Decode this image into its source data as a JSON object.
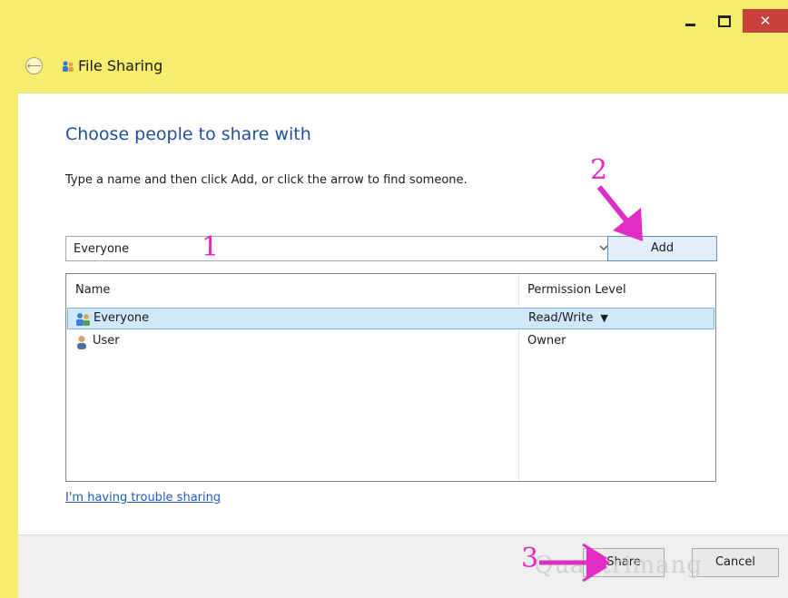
{
  "window": {
    "minimize_icon": "minimize-icon",
    "maximize_icon": "maximize-icon",
    "close_glyph": "✕"
  },
  "header": {
    "back_glyph": "⟵",
    "title": "File Sharing"
  },
  "content": {
    "heading": "Choose people to share with",
    "instruction": "Type a name and then click Add, or click the arrow to find someone.",
    "name_input": {
      "value": "Everyone",
      "arrow_glyph": "⌄"
    },
    "add_label": "Add",
    "table": {
      "headers": {
        "name": "Name",
        "permission": "Permission Level"
      },
      "rows": [
        {
          "name": "Everyone",
          "permission": "Read/Write",
          "selected": true,
          "icon": "group-icon"
        },
        {
          "name": "User",
          "permission": "Owner",
          "selected": false,
          "icon": "user-icon"
        }
      ]
    },
    "trouble_link": "I'm having trouble sharing"
  },
  "footer": {
    "share_label": "Share",
    "cancel_label": "Cancel"
  },
  "annotations": {
    "step1": "1",
    "step2": "2",
    "step3": "3",
    "arrow_color": "#e02ec5"
  },
  "watermark": "Quantrimang",
  "colors": {
    "window_frame": "#f6ec6e",
    "close_button": "#c7423a",
    "heading": "#1f4e9c",
    "selected_row": "#cfe8fa",
    "link": "#1f5bbd"
  }
}
